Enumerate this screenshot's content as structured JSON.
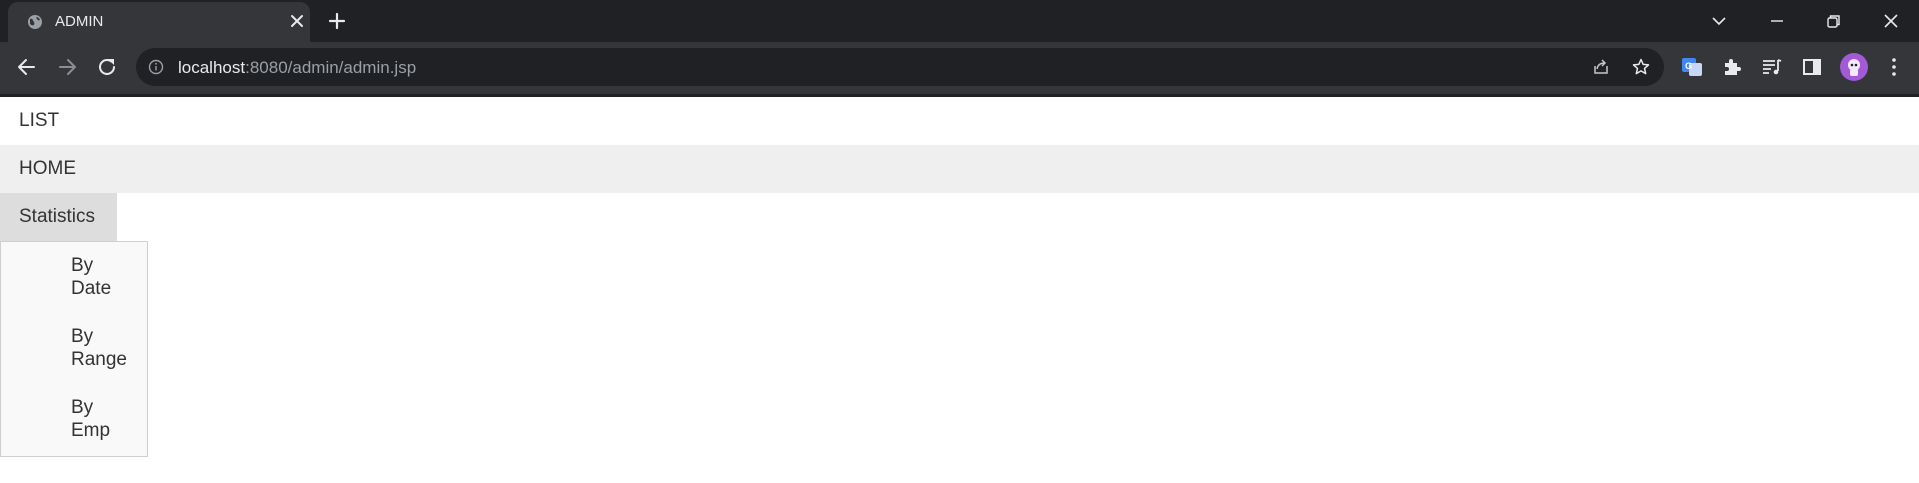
{
  "browser": {
    "tab_title": "ADMIN",
    "url_host": "localhost",
    "url_rest": ":8080/admin/admin.jsp",
    "colors": {
      "frame": "#202124",
      "toolbar": "#35363a",
      "text": "#e8eaed",
      "muted": "#9aa0a6"
    },
    "icons": [
      "globe-icon",
      "close-icon",
      "plus-icon",
      "chevron-down-icon",
      "minimize-icon",
      "restore-icon",
      "back-icon",
      "forward-icon",
      "reload-icon",
      "info-icon",
      "share-icon",
      "star-icon",
      "translate-icon",
      "puzzle-icon",
      "media-icon",
      "sidepanel-icon",
      "avatar",
      "kebab-menu-icon"
    ]
  },
  "menu": {
    "list_label": "LIST",
    "home_label": "HOME",
    "statistics_label": "Statistics",
    "dropdown": [
      {
        "line1": "By",
        "line2": "Date"
      },
      {
        "line1": "By",
        "line2": "Range"
      },
      {
        "line1": "By",
        "line2": "Emp"
      }
    ]
  }
}
